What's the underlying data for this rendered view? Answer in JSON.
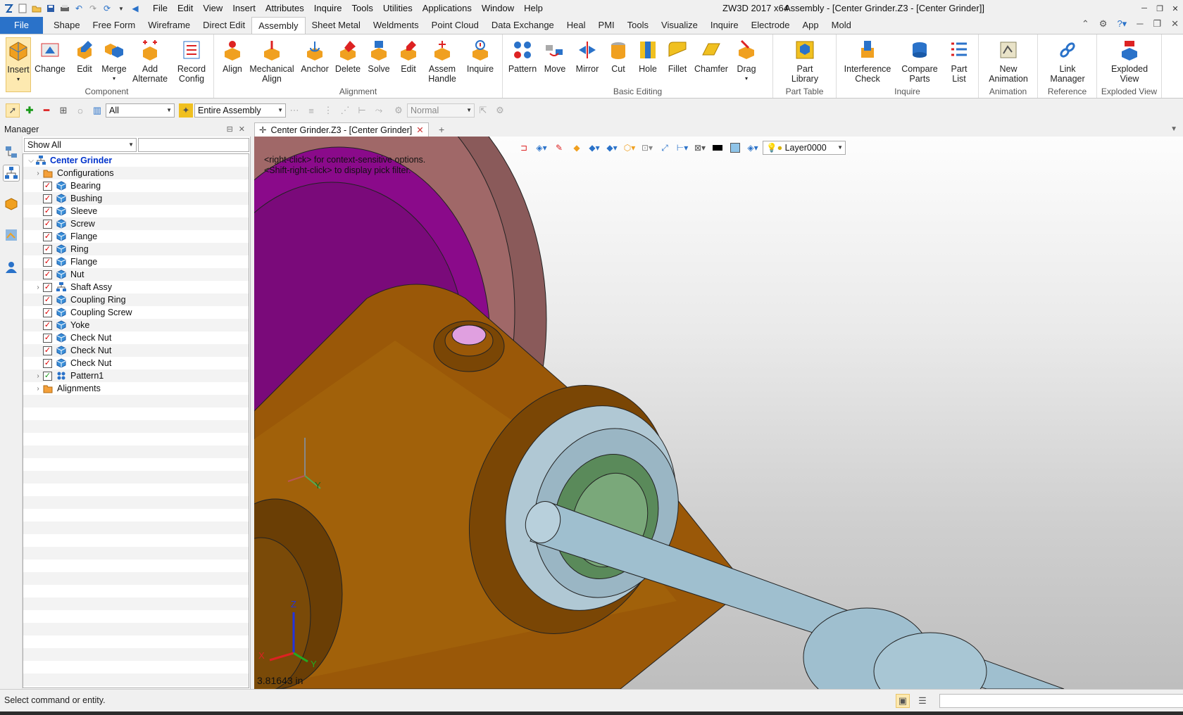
{
  "window": {
    "app_name": "ZW3D 2017  x64",
    "title": "Assembly - [Center Grinder.Z3 - [Center Grinder]]"
  },
  "menu": [
    "File",
    "Edit",
    "View",
    "Insert",
    "Attributes",
    "Inquire",
    "Tools",
    "Utilities",
    "Applications",
    "Window",
    "Help"
  ],
  "ribbon_tabs": [
    "File",
    "Shape",
    "Free Form",
    "Wireframe",
    "Direct Edit",
    "Assembly",
    "Sheet Metal",
    "Weldments",
    "Point Cloud",
    "Data Exchange",
    "Heal",
    "PMI",
    "Tools",
    "Visualize",
    "Inquire",
    "Electrode",
    "App",
    "Mold"
  ],
  "active_tab": "Assembly",
  "ribbon": {
    "component": {
      "label": "Component",
      "insert": "Insert",
      "change": "Change",
      "edit": "Edit",
      "merge": "Merge",
      "add_alternate": "Add\nAlternate",
      "record_config": "Record\nConfig"
    },
    "alignment": {
      "label": "Alignment",
      "align": "Align",
      "mech_align": "Mechanical\nAlign",
      "anchor": "Anchor",
      "delete": "Delete",
      "solve": "Solve",
      "edit": "Edit",
      "assem_handle": "Assem\nHandle",
      "inquire": "Inquire"
    },
    "basic_editing": {
      "label": "Basic Editing",
      "pattern": "Pattern",
      "move": "Move",
      "mirror": "Mirror",
      "cut": "Cut",
      "hole": "Hole",
      "fillet": "Fillet",
      "chamfer": "Chamfer",
      "drag": "Drag"
    },
    "part_table": {
      "label": "Part Table",
      "part_library": "Part\nLibrary"
    },
    "inquire": {
      "label": "Inquire",
      "interference": "Interference\nCheck",
      "compare": "Compare\nParts",
      "part_list": "Part\nList"
    },
    "animation": {
      "label": "Animation",
      "new_animation": "New\nAnimation"
    },
    "reference": {
      "label": "Reference",
      "link_manager": "Link\nManager"
    },
    "exploded": {
      "label": "Exploded View",
      "exploded_view": "Exploded\nView"
    }
  },
  "toolbar2": {
    "filter_value": "All",
    "scope_value": "Entire Assembly",
    "mode_value": "Normal"
  },
  "manager": {
    "title": "Manager",
    "show_value": "Show All",
    "root": "Center Grinder",
    "items": [
      {
        "label": "Configurations",
        "type": "folder",
        "expand": true,
        "check": ""
      },
      {
        "label": "Bearing",
        "type": "part",
        "expand": false,
        "check": "red"
      },
      {
        "label": "Bushing",
        "type": "part",
        "expand": false,
        "check": "red"
      },
      {
        "label": "Sleeve",
        "type": "part",
        "expand": false,
        "check": "red"
      },
      {
        "label": "Screw",
        "type": "part",
        "expand": false,
        "check": "red"
      },
      {
        "label": "Flange",
        "type": "part",
        "expand": false,
        "check": "red"
      },
      {
        "label": "Ring",
        "type": "part",
        "expand": false,
        "check": "red"
      },
      {
        "label": "Flange",
        "type": "part",
        "expand": false,
        "check": "red"
      },
      {
        "label": "Nut",
        "type": "part",
        "expand": false,
        "check": "red"
      },
      {
        "label": "Shaft Assy",
        "type": "assy",
        "expand": true,
        "check": "red"
      },
      {
        "label": "Coupling Ring",
        "type": "part",
        "expand": false,
        "check": "red"
      },
      {
        "label": "Coupling Screw",
        "type": "part",
        "expand": false,
        "check": "red"
      },
      {
        "label": "Yoke",
        "type": "part",
        "expand": false,
        "check": "red"
      },
      {
        "label": "Check Nut",
        "type": "part",
        "expand": false,
        "check": "red"
      },
      {
        "label": "Check Nut",
        "type": "part",
        "expand": false,
        "check": "red"
      },
      {
        "label": "Check Nut",
        "type": "part",
        "expand": false,
        "check": "red"
      },
      {
        "label": "Pattern1",
        "type": "pattern",
        "expand": true,
        "check": "grn"
      },
      {
        "label": "Alignments",
        "type": "folder",
        "expand": true,
        "check": ""
      }
    ]
  },
  "doc_tab": "Center Grinder.Z3 - [Center Grinder]",
  "viewport": {
    "hint_line1": "<right-click> for context-sensitive options.",
    "hint_line2": "<Shift-right-click> to display pick filter.",
    "layer": "Layer0000",
    "measurement": "3.81643 in",
    "axis_x": "X",
    "axis_y": "Y",
    "axis_z": "Z"
  },
  "status": "Select command or entity.",
  "colors": {
    "accent": "#2a72c9",
    "part_body": "#a0600a",
    "disc_magenta": "#8a0a8a",
    "shaft": "#9fbfcf"
  }
}
